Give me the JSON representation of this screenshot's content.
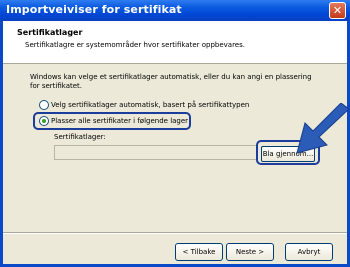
{
  "window": {
    "title": "Importveiviser for sertifikat",
    "close_glyph": "✕"
  },
  "header": {
    "title": "Sertifikatlager",
    "subtitle": "Sertifikatlagre er systemområder hvor sertifikater oppbevares."
  },
  "body": {
    "description": "Windows kan velge et sertifikatlager automatisk, eller du kan angi en plassering for sertifikatet.",
    "radio_auto": "Velg sertifikatlager automatisk, basert på sertifikattypen",
    "radio_manual": "Plasser alle sertifikater i følgende lager",
    "store_label": "Sertifikatlager:",
    "store_value": "",
    "browse_button": "Bla gjennom..."
  },
  "footer": {
    "back_button": "< Tilbake",
    "next_button": "Neste >",
    "cancel_button": "Avbryt"
  },
  "selected_option": "radio_manual",
  "colors": {
    "title_bar": "#0a49c8",
    "highlight": "#1c3d9c",
    "arrow": "#2a5cb8"
  }
}
